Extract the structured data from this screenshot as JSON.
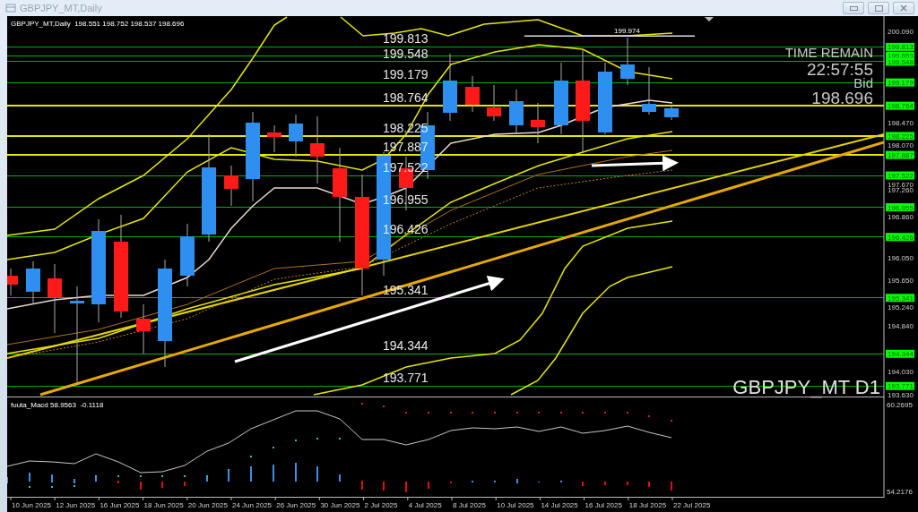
{
  "window": {
    "title": "GBPJPY_MT,Daily"
  },
  "chart": {
    "header": "GBPJPY_MT,Daily  198.551 198.752 198.537 198.696",
    "high_label": "199.974",
    "info": [
      {
        "kind": "label",
        "text": "TIME REMAIN"
      },
      {
        "kind": "value",
        "text": "22:57:55"
      },
      {
        "kind": "label",
        "text": "Bid"
      },
      {
        "kind": "value",
        "text": "198.696"
      }
    ],
    "symbol_label": "GBPJPY_MT D1",
    "levels": [
      {
        "chart_label": "199.813",
        "axis_label": "199.813",
        "color": "#00b000"
      },
      {
        "axis_label": "199.653",
        "color": "#00b000"
      },
      {
        "chart_label": "199.548",
        "axis_label": "199.548",
        "color": "#00b000"
      },
      {
        "chart_label": "199.179",
        "axis_label": "199.179",
        "color": "#00b000"
      },
      {
        "chart_label": "198.764",
        "axis_label": "198.764",
        "color": "#e6e600"
      },
      {
        "chart_label": "198.225",
        "axis_label": "198.225",
        "color": "#e6e600"
      },
      {
        "chart_label": "197.887",
        "axis_label": "197.887",
        "color": "#e6e600"
      },
      {
        "chart_label": "197.522",
        "axis_label": "197.522",
        "color": "#00b000"
      },
      {
        "chart_label": "196.955",
        "axis_label": "196.955",
        "color": "#00b000"
      },
      {
        "chart_label": "196.426",
        "axis_label": "196.426",
        "color": "#00b000"
      },
      {
        "chart_label": "195.341",
        "axis_label": "195.341",
        "color": "#00b000"
      },
      {
        "chart_label": "194.344",
        "axis_label": "194.344",
        "color": "#00b000"
      },
      {
        "chart_label": "193.771",
        "axis_label": "193.771",
        "color": "#00b000"
      }
    ],
    "axis_ticks": [
      "200.090",
      "198.470",
      "198.070",
      "197.670",
      "197.260",
      "196.860",
      "196.050",
      "195.650",
      "195.240",
      "194.840",
      "194.030",
      "193.630"
    ]
  },
  "macd": {
    "label": "fuuta_Macd 58.9563  -0.1118",
    "axis_max": "60.2695",
    "axis_min": "54.2176"
  },
  "dates": [
    "10 Jun 2025",
    "12 Jun 2025",
    "16 Jun 2025",
    "18 Jun 2025",
    "20 Jun 2025",
    "24 Jun 2025",
    "26 Jun 2025",
    "30 Jun 2025",
    "2 Jul 2025",
    "4 Jul 2025",
    "8 Jul 2025",
    "10 Jul 2025",
    "14 Jul 2025",
    "16 Jul 2025",
    "18 Jul 2025",
    "22 Jul 2025"
  ]
}
